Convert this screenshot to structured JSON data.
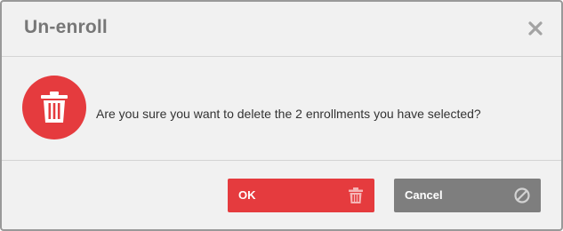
{
  "dialog": {
    "title": "Un-enroll",
    "close_icon": "close-icon",
    "message": "Are you sure you want to delete the 2 enrollments you have selected?",
    "main_icon": "trash-icon",
    "ok_label": "OK",
    "ok_icon": "trash-icon",
    "cancel_label": "Cancel",
    "cancel_icon": "cancel-icon"
  },
  "colors": {
    "danger": "#e53b3e",
    "secondary": "#7e7e7e",
    "title_text": "#777777",
    "background": "#f1f1f1"
  }
}
